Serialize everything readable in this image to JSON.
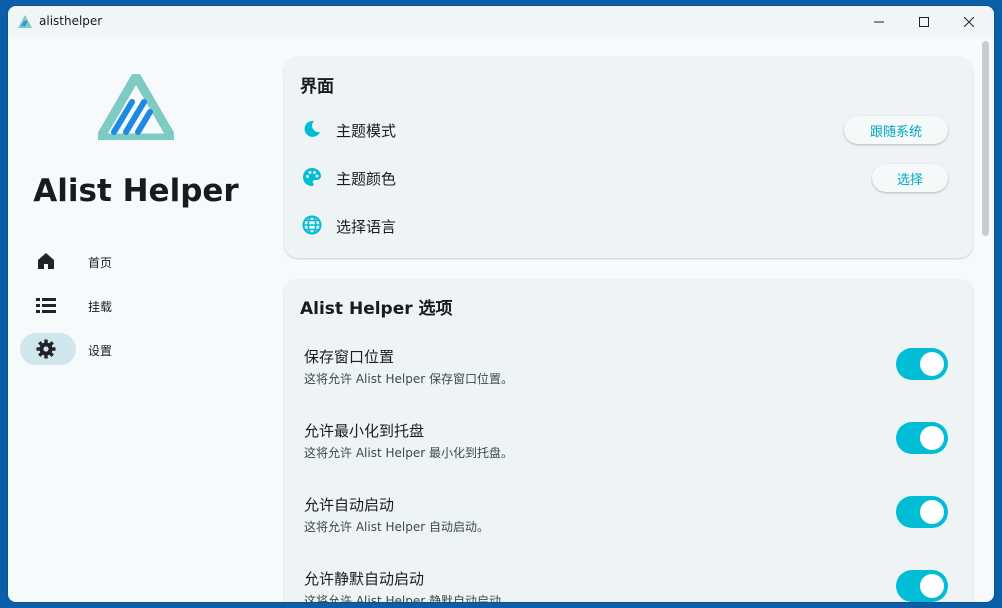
{
  "window": {
    "title": "alisthelper"
  },
  "sidebar": {
    "brand": "Alist Helper",
    "items": [
      {
        "label": "首页",
        "icon": "home-icon"
      },
      {
        "label": "挂载",
        "icon": "list-icon"
      },
      {
        "label": "设置",
        "icon": "gear-icon",
        "active": true
      }
    ]
  },
  "interface": {
    "title": "界面",
    "rows": [
      {
        "label": "主题模式",
        "icon": "moon-icon",
        "button": "跟随系统"
      },
      {
        "label": "主题颜色",
        "icon": "palette-icon",
        "button": "选择"
      },
      {
        "label": "选择语言",
        "icon": "globe-icon"
      }
    ]
  },
  "options": {
    "title": "Alist Helper 选项",
    "items": [
      {
        "title": "保存窗口位置",
        "desc": "这将允许 Alist Helper 保存窗口位置。",
        "on": true
      },
      {
        "title": "允许最小化到托盘",
        "desc": "这将允许 Alist Helper 最小化到托盘。",
        "on": true
      },
      {
        "title": "允许自动启动",
        "desc": "这将允许 Alist Helper 自动启动。",
        "on": true
      },
      {
        "title": "允许静默自动启动",
        "desc": "这将允许 Alist Helper 静默自动启动。",
        "on": true
      }
    ]
  },
  "colors": {
    "accent": "#00bcd4",
    "logo_teal": "#7ecbc3",
    "logo_blue": "#1e88e5"
  }
}
